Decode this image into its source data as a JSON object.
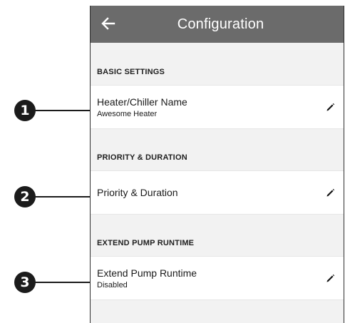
{
  "header": {
    "title": "Configuration",
    "back_icon": "arrow-left-icon"
  },
  "sections": [
    {
      "header": "BASIC SETTINGS",
      "row": {
        "title": "Heater/Chiller Name",
        "subtitle": "Awesome Heater",
        "edit_icon": "pencil-icon"
      }
    },
    {
      "header": "PRIORITY & DURATION",
      "row": {
        "title": "Priority & Duration",
        "subtitle": "",
        "edit_icon": "pencil-icon"
      }
    },
    {
      "header": "EXTEND PUMP RUNTIME",
      "row": {
        "title": "Extend Pump Runtime",
        "subtitle": "Disabled",
        "edit_icon": "pencil-icon"
      }
    }
  ],
  "callouts": [
    "1",
    "2",
    "3"
  ],
  "colors": {
    "header_bg": "#6b6b6b",
    "screen_bg": "#f2f2f2",
    "row_bg": "#ffffff",
    "callout_bg": "#1b1b1b"
  }
}
